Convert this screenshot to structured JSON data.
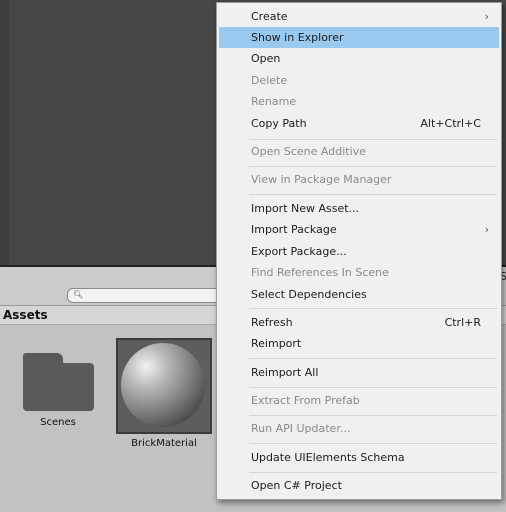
{
  "project": {
    "assets_title": "Assets",
    "right_edge_text": "S",
    "search": {
      "placeholder": ""
    },
    "items": [
      {
        "label": "Scenes",
        "type": "folder"
      },
      {
        "label": "BrickMaterial",
        "type": "material"
      }
    ]
  },
  "context_menu": {
    "items": [
      {
        "label": "Create",
        "submenu": true
      },
      {
        "label": "Show in Explorer",
        "highlighted": true
      },
      {
        "label": "Open"
      },
      {
        "label": "Delete",
        "disabled": true
      },
      {
        "label": "Rename",
        "disabled": true
      },
      {
        "label": "Copy Path",
        "shortcut": "Alt+Ctrl+C"
      },
      {
        "label": "Open Scene Additive",
        "disabled": true
      },
      {
        "label": "View in Package Manager",
        "disabled": true
      },
      {
        "label": "Import New Asset..."
      },
      {
        "label": "Import Package",
        "submenu": true
      },
      {
        "label": "Export Package..."
      },
      {
        "label": "Find References In Scene",
        "disabled": true
      },
      {
        "label": "Select Dependencies"
      },
      {
        "label": "Refresh",
        "shortcut": "Ctrl+R"
      },
      {
        "label": "Reimport"
      },
      {
        "label": "Reimport All"
      },
      {
        "label": "Extract From Prefab",
        "disabled": true
      },
      {
        "label": "Run API Updater...",
        "disabled": true
      },
      {
        "label": "Update UIElements Schema"
      },
      {
        "label": "Open C# Project"
      }
    ],
    "submenu_arrow": "›"
  },
  "icons": {
    "search": "magnifier-icon",
    "folder": "folder-icon",
    "material": "material-sphere-icon"
  },
  "colors": {
    "menu_highlight": "#99c9ef",
    "menu_background": "#f0f0f0",
    "editor_background": "#474747",
    "panel_background": "#c2c2c2"
  }
}
